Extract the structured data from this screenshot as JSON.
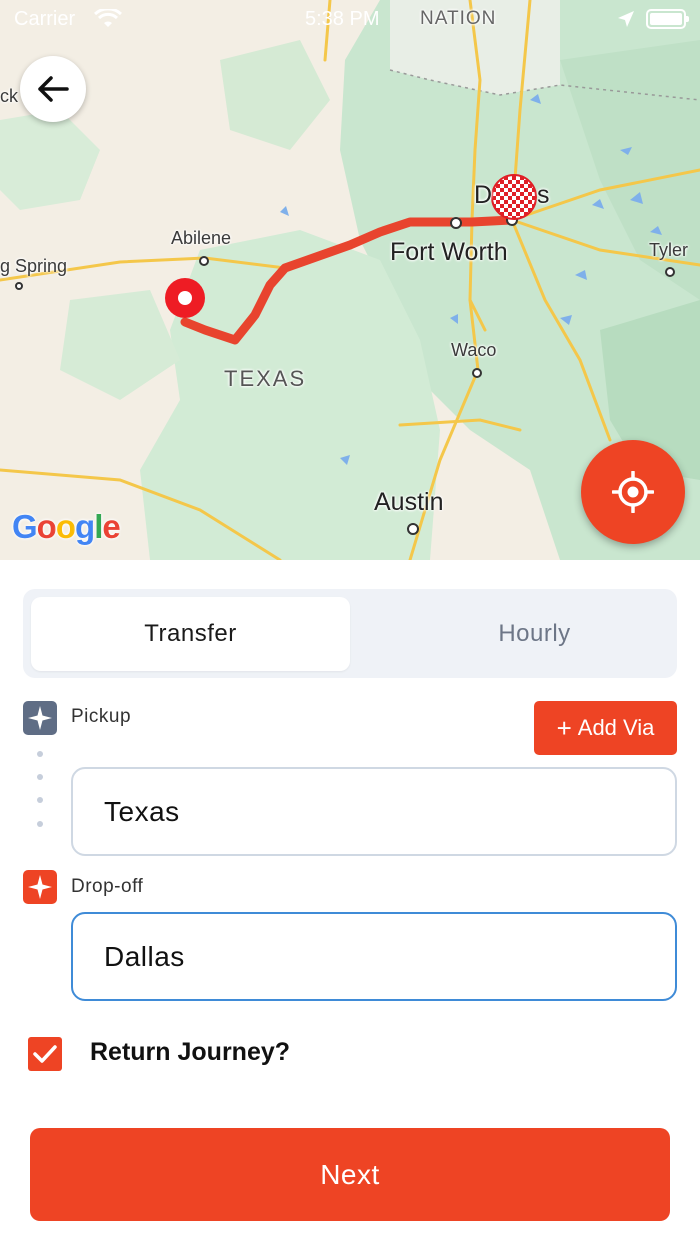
{
  "status_bar": {
    "carrier": "Carrier",
    "time": "5:38 PM",
    "wifi_icon": "wifi-icon",
    "location_icon": "location-arrow-icon",
    "battery_icon": "battery-icon"
  },
  "map": {
    "labels": {
      "nation": "NATION",
      "partial_left": "ck",
      "abilene": "Abilene",
      "big_spring": "g Spring",
      "dallas_left": "D",
      "dallas_right": "s",
      "fort_worth": "Fort Worth",
      "tyler": "Tyler",
      "waco": "Waco",
      "texas": "TEXAS",
      "austin": "Austin"
    },
    "google_logo": "Google",
    "route_color": "#e8442e",
    "back_icon": "arrow-left-icon",
    "locate_icon": "crosshair-icon"
  },
  "tabs": [
    {
      "label": "Transfer",
      "active": true
    },
    {
      "label": "Hourly",
      "active": false
    }
  ],
  "pickup": {
    "label": "Pickup",
    "value": "Texas",
    "icon": "pickup-marker-icon"
  },
  "add_via": {
    "label": "Add Via",
    "icon": "plus-icon"
  },
  "dropoff": {
    "label": "Drop-off",
    "value": "Dallas",
    "icon": "dropoff-marker-icon"
  },
  "return_journey": {
    "label": "Return Journey?",
    "checked": true
  },
  "next_button": {
    "label": "Next"
  },
  "colors": {
    "accent": "#ee4424",
    "pickup_icon_bg": "#5f6d85",
    "focus_border": "#3f8bd7"
  }
}
